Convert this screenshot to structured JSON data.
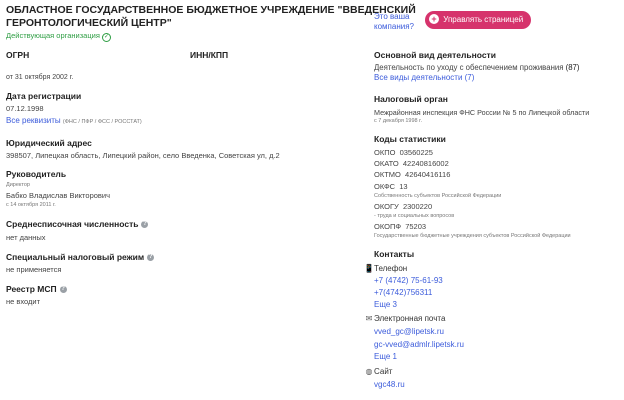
{
  "org": {
    "title_line1": "ОБЛАСТНОЕ ГОСУДАРСТВЕННОЕ БЮДЖЕТНОЕ УЧРЕЖДЕНИЕ \"ВВЕДЕНСКИЙ",
    "title_line2": "ГЕРОНТОЛОГИЧЕСКИЙ ЦЕНТР\"",
    "status": "Действующая организация"
  },
  "promo": {
    "question_line1": "Это ваша",
    "question_line2": "компания?",
    "button": "Управлять страницей"
  },
  "ogrn": {
    "label": "ОГРН",
    "date": "от 31 октября 2002 г."
  },
  "inn": {
    "label": "ИНН/КПП"
  },
  "registration": {
    "label": "Дата регистрации",
    "value": "07.12.1998",
    "link": "Все реквизиты",
    "note": "(ФНС / ПФР / ФСС / РОССТАТ)"
  },
  "address": {
    "label": "Юридический адрес",
    "value": "398507, Липецкая область, Липецкий район, село Введенка, Советская ул, д.2"
  },
  "head": {
    "label": "Руководитель",
    "role": "Директор",
    "name": "Бабко Владислав Викторович",
    "since": "с 14 октября 2011 г."
  },
  "headcount": {
    "label": "Среднесписочная численность",
    "value": "нет данных"
  },
  "tax_regime": {
    "label": "Специальный налоговый режим",
    "value": "не применяется"
  },
  "msp": {
    "label": "Реестр МСП",
    "value": "не входит"
  },
  "activity": {
    "label": "Основной вид деятельности",
    "value": "Деятельность по уходу с обеспечением проживания",
    "count": "(87)",
    "link": "Все виды деятельности (7)"
  },
  "tax_office": {
    "label": "Налоговый орган",
    "value": "Межрайонная инспекция ФНС России № 5 по Липецкой области",
    "since": "с 7 декабря 1998 г."
  },
  "stats": {
    "label": "Коды статистики",
    "okpo": "ОКПО  03560225",
    "okato": "ОКАТО  42240816002",
    "oktmo": "ОКТМО  42640416116",
    "okfs": "ОКФС  13",
    "okfs_note": "Собственность субъектов Российской Федерации",
    "okogu": "ОКОГУ  2300220",
    "okogu_note": "- труда и социальных вопросов",
    "okopf": "ОКОПФ  75203",
    "okopf_note": "Государственные бюджетные учреждения субъектов Российской Федерации"
  },
  "contacts": {
    "label": "Контакты",
    "phone_label": "Телефон",
    "phone1": "+7 (4742) 75-61-93",
    "phone2": "+7(4742)756311",
    "phone_more": "Еще 3",
    "email_label": "Электронная почта",
    "email1": "vved_gc@lipetsk.ru",
    "email2": "gc-vved@admlr.lipetsk.ru",
    "email_more": "Еще 1",
    "site_label": "Сайт",
    "site": "vgc48.ru"
  },
  "colors": {
    "accent": "#d6336c",
    "link": "#3b5bdb",
    "ok": "#2f9e44"
  }
}
